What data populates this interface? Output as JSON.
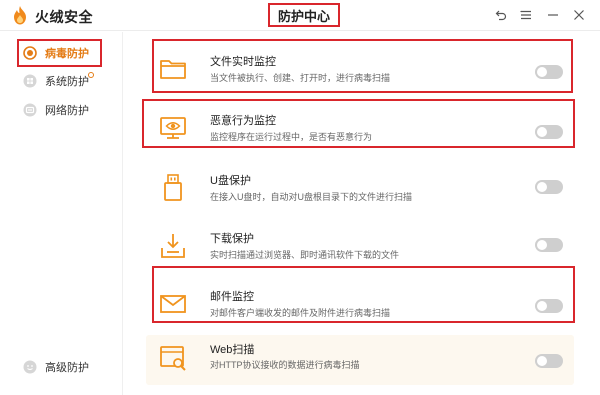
{
  "app": {
    "name": "火绒安全",
    "page_title": "防护中心"
  },
  "colors": {
    "accent": "#e47c16",
    "highlight": "#d9262c",
    "toggle_off": "#cfcfcf"
  },
  "window_controls": [
    {
      "name": "back-icon",
      "glyph": "⤺"
    },
    {
      "name": "menu-icon",
      "glyph": "☰"
    },
    {
      "name": "minimize-icon",
      "glyph": "—"
    },
    {
      "name": "close-icon",
      "glyph": "✕"
    }
  ],
  "sidebar": {
    "items": [
      {
        "label": "病毒防护",
        "icon": "plus-shield-icon",
        "active": true
      },
      {
        "label": "系统防护",
        "icon": "windows-icon",
        "active": false,
        "badge": true
      },
      {
        "label": "网络防护",
        "icon": "globe-icon",
        "active": false
      },
      {
        "label": "高级防护",
        "icon": "smiley-icon",
        "active": false
      }
    ]
  },
  "protections": [
    {
      "title": "文件实时监控",
      "desc": "当文件被执行、创建、打开时，进行病毒扫描",
      "icon": "folder-icon",
      "enabled": false
    },
    {
      "title": "恶意行为监控",
      "desc": "监控程序在运行过程中，是否有恶意行为",
      "icon": "monitor-eye-icon",
      "enabled": false
    },
    {
      "title": "U盘保护",
      "desc": "在接入U盘时，自动对U盘根目录下的文件进行扫描",
      "icon": "usb-icon",
      "enabled": false
    },
    {
      "title": "下载保护",
      "desc": "实时扫描通过浏览器、即时通讯软件下载的文件",
      "icon": "download-icon",
      "enabled": false
    },
    {
      "title": "邮件监控",
      "desc": "对邮件客户端收发的邮件及附件进行病毒扫描",
      "icon": "mail-icon",
      "enabled": false
    },
    {
      "title": "Web扫描",
      "desc": "对HTTP协议接收的数据进行病毒扫描",
      "icon": "web-scan-icon",
      "enabled": false
    }
  ]
}
